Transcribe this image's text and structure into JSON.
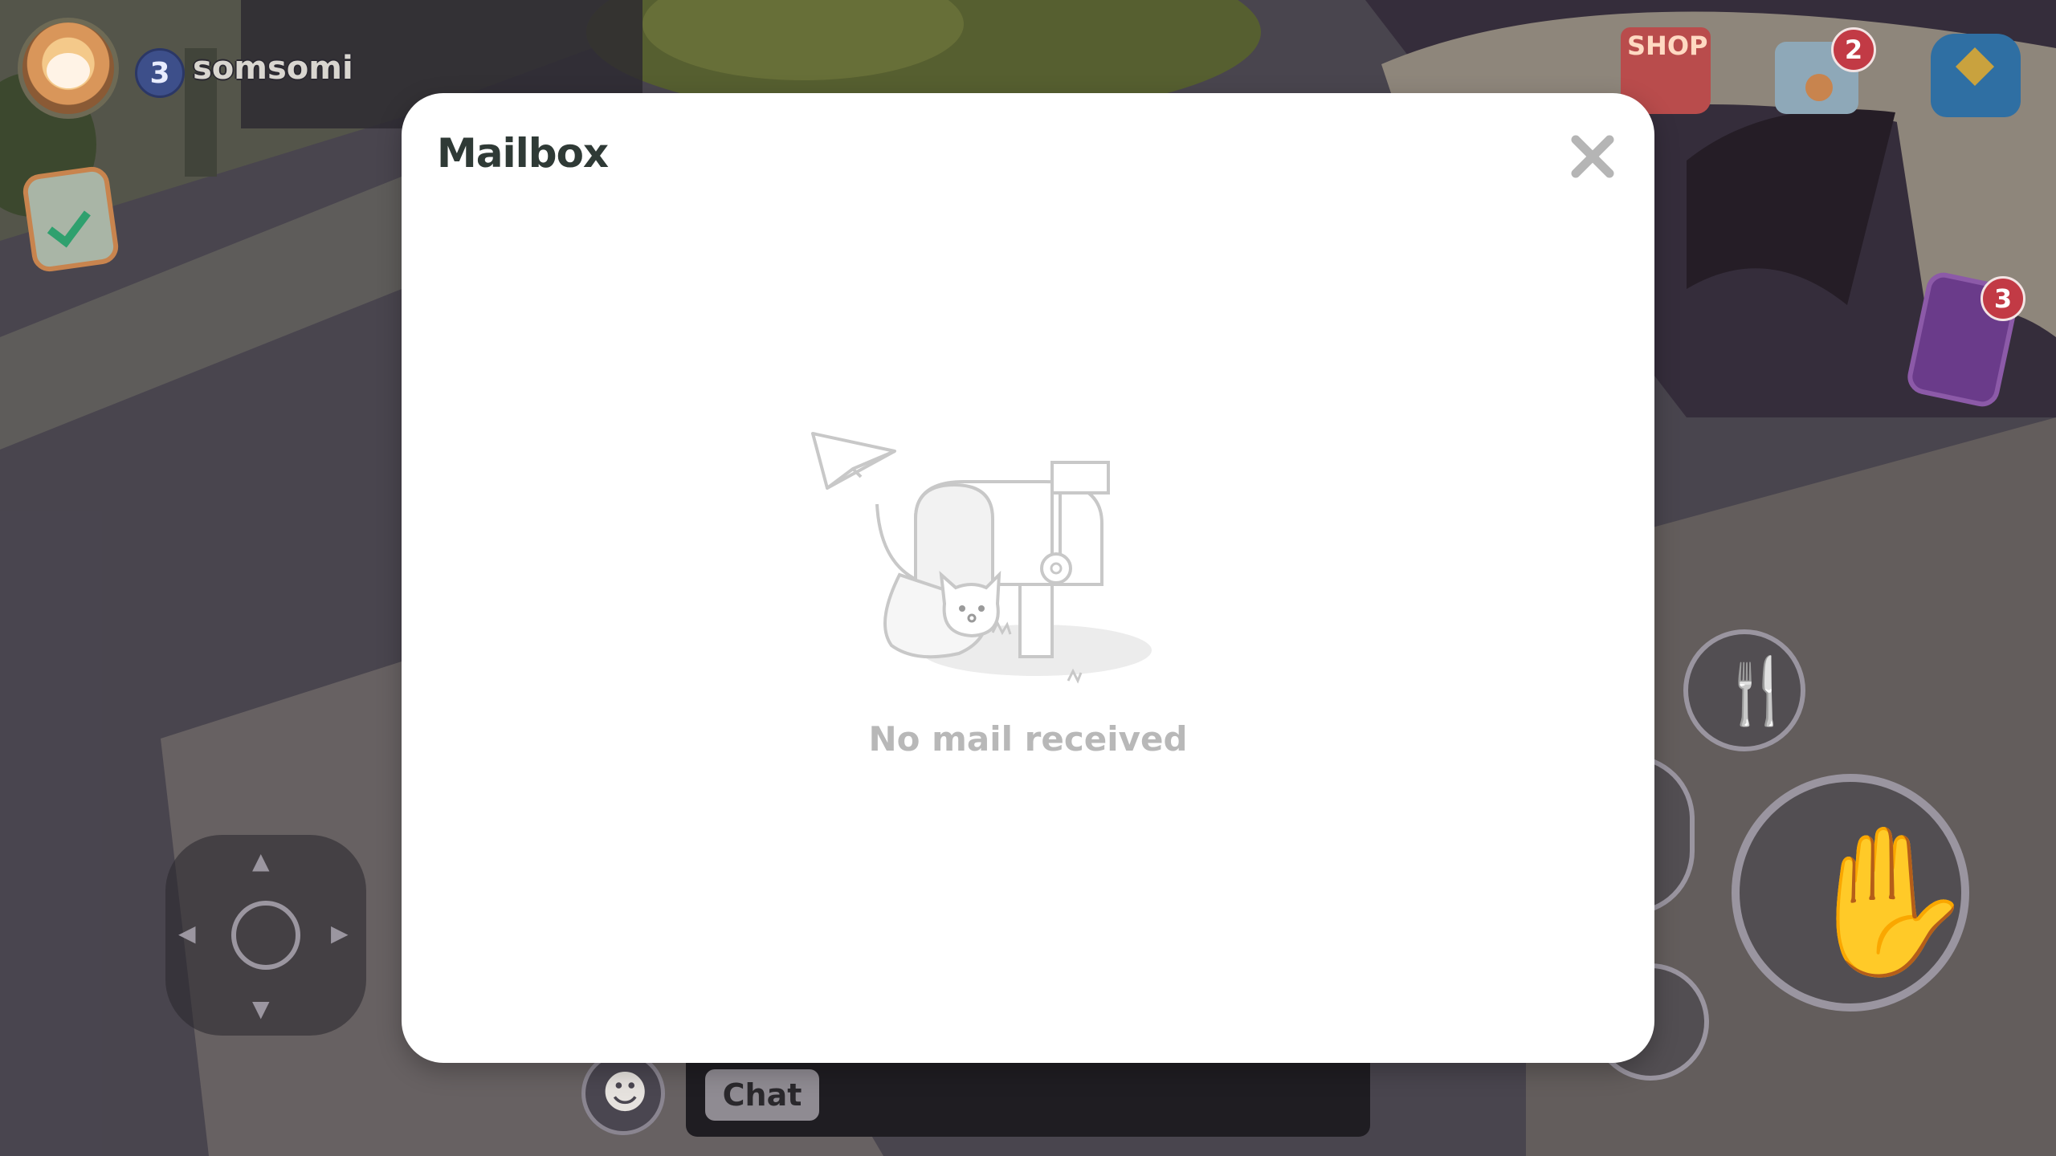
{
  "player": {
    "level": "3",
    "name": "somsomi"
  },
  "hud": {
    "shop_label": "SHOP",
    "mail_badge": "2",
    "phone_badge": "3"
  },
  "chat": {
    "button_label": "Chat"
  },
  "mailbox": {
    "title": "Mailbox",
    "empty_message": "No mail received"
  }
}
